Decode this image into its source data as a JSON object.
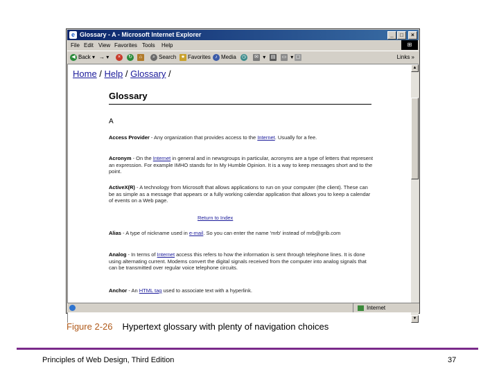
{
  "window": {
    "title": "Glossary - A - Microsoft Internet Explorer",
    "controls": {
      "minimize": "_",
      "maximize": "□",
      "close": "×"
    }
  },
  "menu": [
    "File",
    "Edit",
    "View",
    "Favorites",
    "Tools",
    "Help"
  ],
  "toolbar": {
    "back": "Back",
    "forward": "→",
    "search": "Search",
    "favorites": "Favorites",
    "media": "Media",
    "links": "Links »"
  },
  "breadcrumb": {
    "home": "Home",
    "sep1": " / ",
    "help": "Help",
    "sep2": " / ",
    "glossary": "Glossary",
    "sep3": " /"
  },
  "page": {
    "title": "Glossary",
    "letter": "A",
    "return_link": "Return to Index"
  },
  "entries": [
    {
      "term": "Access Provider",
      "pre": " - Any organization that provides access to the ",
      "link": "Internet",
      "post": ". Usually for a fee."
    },
    {
      "term": "Acronym",
      "pre": " - On the ",
      "link": "Internet",
      "post": " in general and in newsgroups in particular, acronyms are a type of letters that represent an expression. For example IMHO stands for In My Humble Opinion. It is a way to keep messages short and to the point."
    },
    {
      "term": "ActiveX(R)",
      "pre": " - A technology from Microsoft that allows applications to run on your computer (the client). These can be as simple as a message that appears or a fully working calendar application that allows you to keep a calendar of events on a Web page.",
      "link": "",
      "post": ""
    },
    {
      "term": "Alias",
      "pre": " - A type of nickname used in ",
      "link": "e-mail",
      "post": ". So you can enter the name 'mrb' instead of mrb@grib.com"
    },
    {
      "term": "Analog",
      "pre": " - In terms of ",
      "link": "Internet",
      "post": " access this refers to how the information is sent through telephone lines. It is done using alternating current. Modems convert the digital signals received from the computer into analog signals that can be transmitted over regular voice telephone circuits."
    },
    {
      "term": "Anchor",
      "pre": " - An ",
      "link": "HTML tag",
      "post": " used to associate text with a hyperlink."
    }
  ],
  "status": {
    "zone": "Internet"
  },
  "caption": {
    "figure_no": "Figure 2-26",
    "text": "Hypertext glossary with plenty of navigation choices"
  },
  "footer": {
    "left": "Principles of Web Design, Third Edition",
    "page_number": "37"
  }
}
